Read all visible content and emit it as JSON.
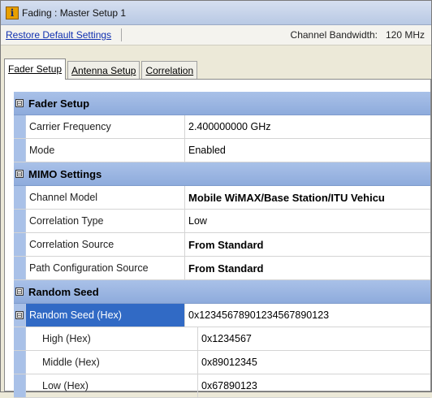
{
  "window": {
    "title": "Fading : Master Setup 1",
    "icon": "info-icon"
  },
  "toolbar": {
    "restore_label": "Restore Default Settings",
    "bandwidth_label": "Channel Bandwidth:",
    "bandwidth_value": "120 MHz"
  },
  "tabs": [
    {
      "label": "Fader Setup",
      "active": true
    },
    {
      "label": "Antenna Setup",
      "active": false
    },
    {
      "label": "Correlation",
      "active": false
    }
  ],
  "grid": {
    "fader": {
      "title": "Fader Setup",
      "carrier_label": "Carrier Frequency",
      "carrier_value": "2.400000000 GHz",
      "mode_label": "Mode",
      "mode_value": "Enabled"
    },
    "mimo": {
      "title": "MIMO Settings",
      "channel_label": "Channel Model",
      "channel_value": "Mobile WiMAX/Base Station/ITU Vehicu",
      "corrtype_label": "Correlation Type",
      "corrtype_value": "Low",
      "corrsrc_label": "Correlation Source",
      "corrsrc_value": "From Standard",
      "pathcfg_label": "Path Configuration Source",
      "pathcfg_value": "From Standard"
    },
    "seed": {
      "title": "Random Seed",
      "hex_label": "Random Seed (Hex)",
      "hex_value": "0x12345678901234567890123",
      "high_label": "High (Hex)",
      "high_value": "0x1234567",
      "middle_label": "Middle (Hex)",
      "middle_value": "0x89012345",
      "low_label": "Low (Hex)",
      "low_value": "0x67890123"
    },
    "expander_glyph": "⊟"
  },
  "colors": {
    "category_bg": "#a9c1e8",
    "selection": "#316ac5",
    "link": "#1030b0"
  }
}
